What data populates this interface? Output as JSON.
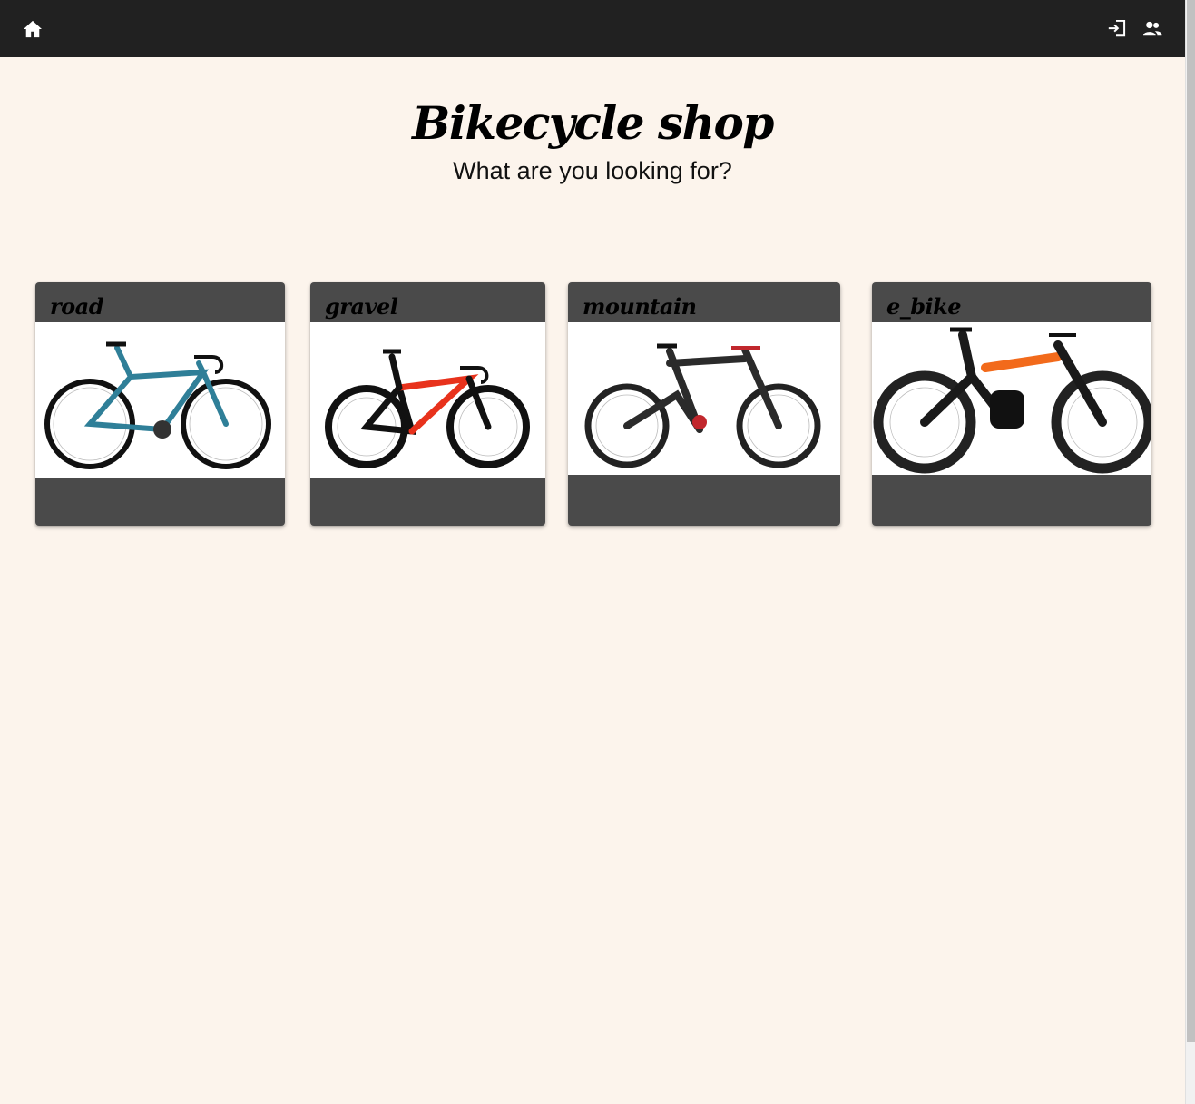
{
  "nav": {
    "home_icon": "home-icon",
    "login_icon": "login-icon",
    "users_icon": "users-icon"
  },
  "hero": {
    "title": "Bikecycle shop",
    "subtitle": "What are you looking for?"
  },
  "categories": [
    {
      "label": "road",
      "frame_color": "#2f7f98",
      "accent": "#1b5a70"
    },
    {
      "label": "gravel",
      "frame_color": "#111111",
      "accent": "#e8321c"
    },
    {
      "label": "mountain",
      "frame_color": "#2b2b2b",
      "accent": "#c1272d"
    },
    {
      "label": "e_bike",
      "frame_color": "#1a1a1a",
      "accent": "#f26a1b"
    }
  ],
  "colors": {
    "appbar": "#212121",
    "background": "#fcf4ec",
    "card": "#4a4a4a"
  }
}
